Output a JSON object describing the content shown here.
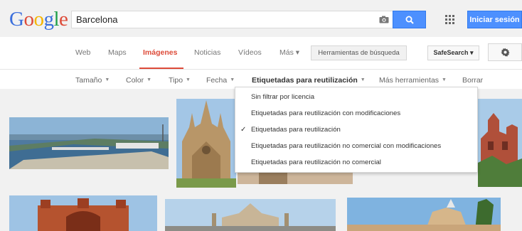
{
  "search": {
    "query": "Barcelona",
    "search_button_icon": "search-icon",
    "camera_icon": "camera-icon"
  },
  "header": {
    "signin_label": "Iniciar sesión",
    "apps_icon": "apps-grid-icon"
  },
  "tabs": [
    {
      "label": "Web",
      "active": false
    },
    {
      "label": "Maps",
      "active": false
    },
    {
      "label": "Imágenes",
      "active": true
    },
    {
      "label": "Noticias",
      "active": false
    },
    {
      "label": "Vídeos",
      "active": false
    },
    {
      "label": "Más ▾",
      "active": false
    }
  ],
  "toolbar": {
    "search_tools_label": "Herramientas de búsqueda",
    "safesearch_label": "SafeSearch ▾",
    "settings_icon": "gear-icon"
  },
  "filters": [
    {
      "label": "Tamaño",
      "active": false
    },
    {
      "label": "Color",
      "active": false
    },
    {
      "label": "Tipo",
      "active": false
    },
    {
      "label": "Fecha",
      "active": false
    },
    {
      "label": "Etiquetadas para reutilización",
      "active": true
    },
    {
      "label": "Más herramientas",
      "active": false
    }
  ],
  "clear_label": "Borrar",
  "dropdown": {
    "items": [
      {
        "label": "Sin filtrar por licencia",
        "checked": false
      },
      {
        "label": "Etiquetadas para reutilización con modificaciones",
        "checked": false
      },
      {
        "label": "Etiquetadas para reutilización",
        "checked": true
      },
      {
        "label": "Etiquetadas para reutilización no comercial con modificaciones",
        "checked": false
      },
      {
        "label": "Etiquetadas para reutilización no comercial",
        "checked": false
      }
    ],
    "check_mark": "✓"
  },
  "colors": {
    "accent_red": "#dd4b39",
    "button_blue": "#4d90fe",
    "header_bg": "#f1f1f1"
  }
}
